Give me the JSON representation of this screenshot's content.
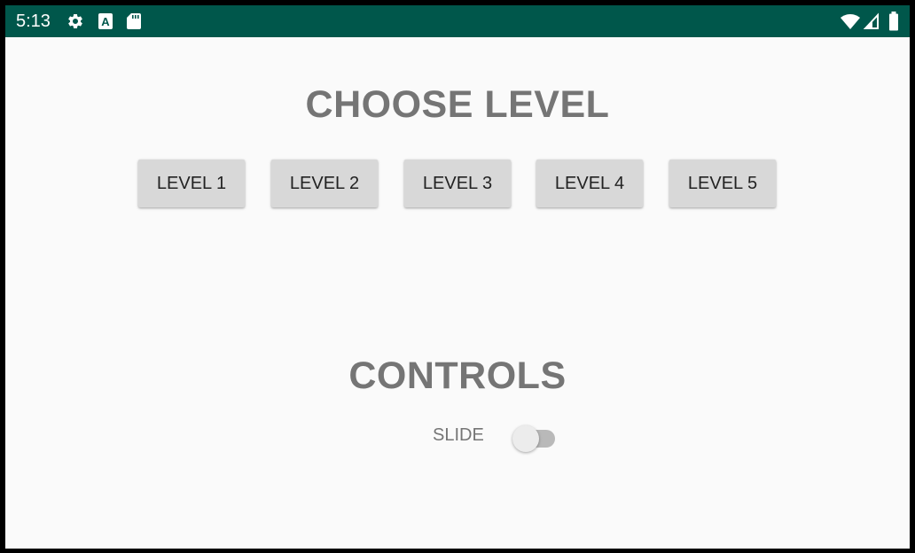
{
  "status_bar": {
    "time": "5:13",
    "icons_left": [
      "gear-icon",
      "a-icon",
      "sd-card-icon"
    ],
    "icons_right": [
      "wifi-icon",
      "signal-icon",
      "battery-icon"
    ],
    "background": "#00574b"
  },
  "choose_level": {
    "title": "CHOOSE LEVEL",
    "buttons": [
      "LEVEL 1",
      "LEVEL 2",
      "LEVEL 3",
      "LEVEL 4",
      "LEVEL 5"
    ]
  },
  "controls": {
    "title": "CONTROLS",
    "slide_label": "SLIDE",
    "slide_switch_on": false
  },
  "colors": {
    "title_text": "#757575",
    "button_bg": "#d8d8d8",
    "page_bg": "#fafafa"
  }
}
